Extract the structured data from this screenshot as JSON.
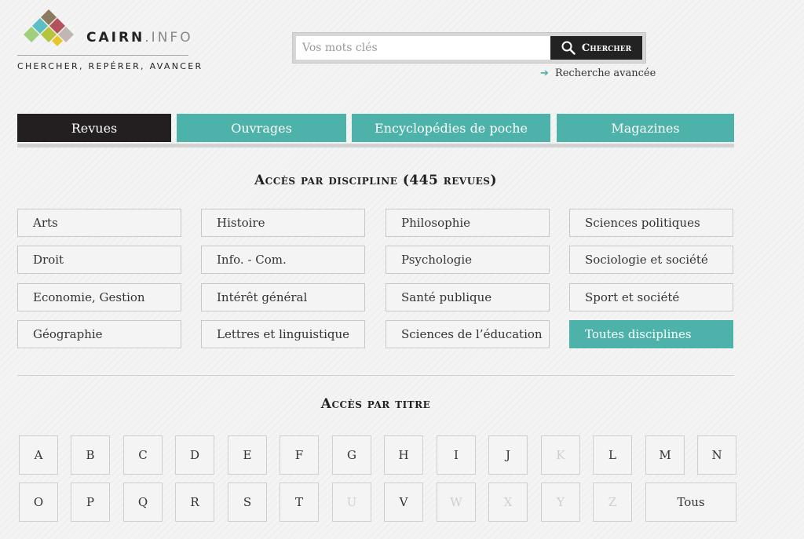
{
  "logo": {
    "brand": "CAIRN",
    "suffix": ".INFO",
    "tagline": "CHERCHER, REPÉRER, AVANCER",
    "colors": [
      "#8c7a5f",
      "#b3525c",
      "#5dbfc6",
      "#b6c33c",
      "#e9c72c",
      "#c0b7b5",
      "#9fcf7a"
    ]
  },
  "search": {
    "placeholder": "Vos mots clés",
    "button_label": "Chercher",
    "advanced_label": "Recherche avancée"
  },
  "tabs": [
    {
      "label": "Revues",
      "active": true
    },
    {
      "label": "Ouvrages",
      "active": false
    },
    {
      "label": "Encyclopédies de poche",
      "active": false
    },
    {
      "label": "Magazines",
      "active": false
    }
  ],
  "discipline": {
    "title": "Accès par discipline (445 revues)",
    "items": [
      "Arts",
      "Histoire",
      "Philosophie",
      "Sciences politiques",
      "Droit",
      "Info. - Com.",
      "Psychologie",
      "Sociologie et société",
      "Economie, Gestion",
      "Intérêt général",
      "Santé publique",
      "Sport et société",
      "Géographie",
      "Lettres et linguistique",
      "Sciences de l’éducation",
      "Toutes disciplines"
    ]
  },
  "title_access": {
    "title": "Accès par titre",
    "letters": [
      {
        "label": "A",
        "enabled": true
      },
      {
        "label": "B",
        "enabled": true
      },
      {
        "label": "C",
        "enabled": true
      },
      {
        "label": "D",
        "enabled": true
      },
      {
        "label": "E",
        "enabled": true
      },
      {
        "label": "F",
        "enabled": true
      },
      {
        "label": "G",
        "enabled": true
      },
      {
        "label": "H",
        "enabled": true
      },
      {
        "label": "I",
        "enabled": true
      },
      {
        "label": "J",
        "enabled": true
      },
      {
        "label": "K",
        "enabled": false
      },
      {
        "label": "L",
        "enabled": true
      },
      {
        "label": "M",
        "enabled": true
      },
      {
        "label": "N",
        "enabled": true
      },
      {
        "label": "O",
        "enabled": true
      },
      {
        "label": "P",
        "enabled": true
      },
      {
        "label": "Q",
        "enabled": true
      },
      {
        "label": "R",
        "enabled": true
      },
      {
        "label": "S",
        "enabled": true
      },
      {
        "label": "T",
        "enabled": true
      },
      {
        "label": "U",
        "enabled": false
      },
      {
        "label": "V",
        "enabled": true
      },
      {
        "label": "W",
        "enabled": false
      },
      {
        "label": "X",
        "enabled": false
      },
      {
        "label": "Y",
        "enabled": false
      },
      {
        "label": "Z",
        "enabled": false
      }
    ],
    "all_label": "Tous"
  },
  "colors": {
    "accent": "#4db3aa",
    "dark": "#231f20"
  },
  "icons": {
    "search": "magnifier-icon",
    "advanced": "arrow-right-icon"
  }
}
